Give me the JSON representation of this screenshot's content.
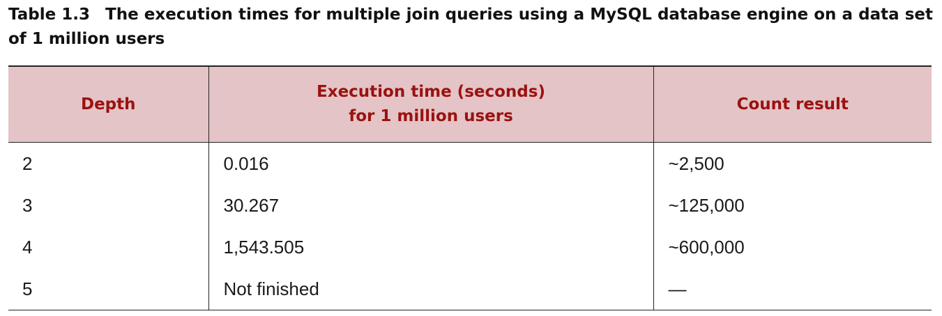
{
  "caption": {
    "number": "Table 1.3",
    "text": "The execution times for multiple join queries using a MySQL database engine on a data set of 1 million users"
  },
  "table": {
    "headers": [
      {
        "lines": [
          "Depth"
        ]
      },
      {
        "lines": [
          "Execution time (seconds)",
          "for 1 million users"
        ]
      },
      {
        "lines": [
          "Count result"
        ]
      }
    ],
    "rows": [
      [
        "2",
        "0.016",
        "~2,500"
      ],
      [
        "3",
        "30.267",
        "~125,000"
      ],
      [
        "4",
        "1,543.505",
        "~600,000"
      ],
      [
        "5",
        "Not finished",
        "—"
      ]
    ]
  },
  "colors": {
    "header_background": "#e4c4c6",
    "header_text": "#9b1111",
    "rule": "#222222"
  }
}
